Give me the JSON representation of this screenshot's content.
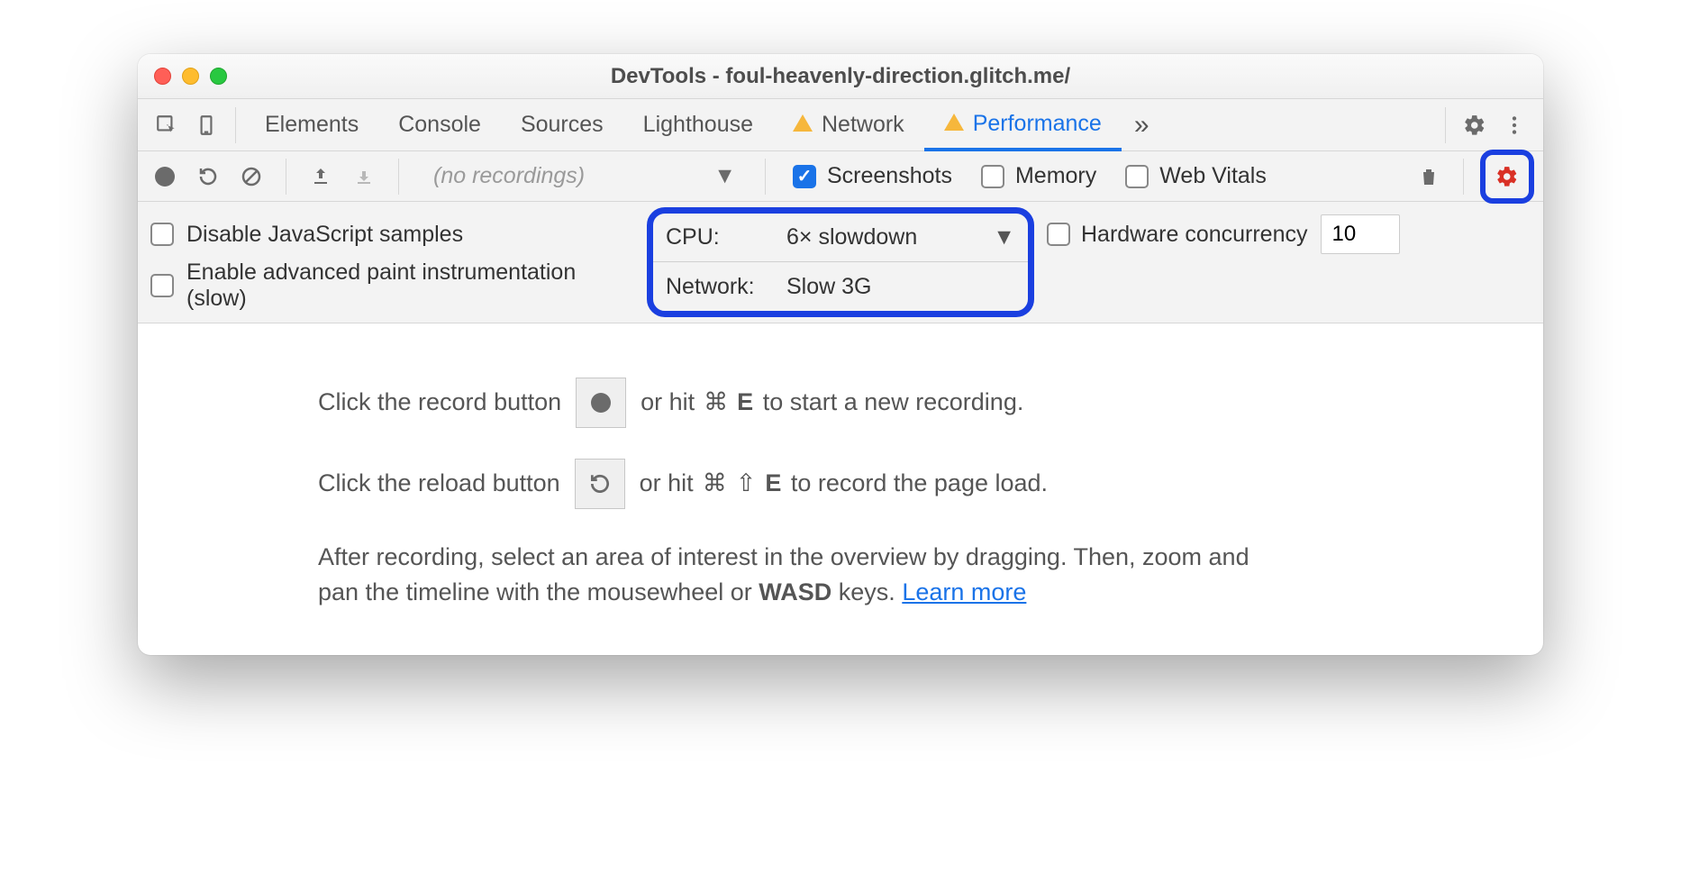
{
  "window": {
    "title": "DevTools - foul-heavenly-direction.glitch.me/"
  },
  "tabs": {
    "items": [
      "Elements",
      "Console",
      "Sources",
      "Lighthouse",
      "Network",
      "Performance"
    ],
    "active": "Performance"
  },
  "toolbar": {
    "recordings_placeholder": "(no recordings)",
    "screenshots_label": "Screenshots",
    "memory_label": "Memory",
    "webvitals_label": "Web Vitals"
  },
  "settings": {
    "disable_js_label": "Disable JavaScript samples",
    "paint_instr_label": "Enable advanced paint instrumentation (slow)",
    "cpu_label": "CPU:",
    "cpu_value": "6× slowdown",
    "network_label": "Network:",
    "network_value": "Slow 3G",
    "hw_label": "Hardware concurrency",
    "hw_value": "10"
  },
  "empty": {
    "line1_a": "Click the record button",
    "line1_b": "or hit",
    "line1_sym": "⌘",
    "line1_key": "E",
    "line1_c": "to start a new recording.",
    "line2_a": "Click the reload button",
    "line2_b": "or hit",
    "line2_sym1": "⌘",
    "line2_sym2": "⇧",
    "line2_key": "E",
    "line2_c": "to record the page load.",
    "para_a": "After recording, select an area of interest in the overview by dragging. Then, zoom and pan the timeline with the mousewheel or ",
    "para_bold": "WASD",
    "para_b": " keys. ",
    "learn_more": "Learn more"
  }
}
